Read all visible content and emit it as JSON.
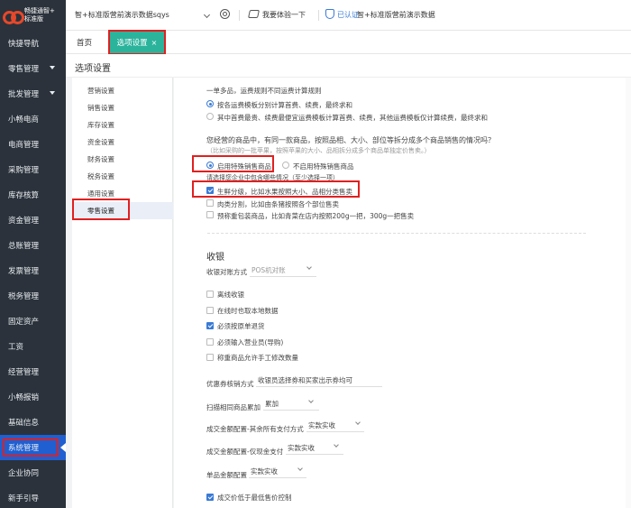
{
  "app": {
    "logo_text": "畅捷通智+\n标准版",
    "account": "智+标准版营前演示数据sqys",
    "try_label": "我要体验一下",
    "cert_label": "已认证",
    "org_label": "智+标准版营前演示数据"
  },
  "sidebar": {
    "items": [
      {
        "label": "快捷导航",
        "caret": false
      },
      {
        "label": "零售管理",
        "caret": true
      },
      {
        "label": "批发管理",
        "caret": true
      },
      {
        "label": "小畅电商",
        "caret": false
      },
      {
        "label": "电商管理",
        "caret": false
      },
      {
        "label": "采购管理",
        "caret": false
      },
      {
        "label": "库存核算",
        "caret": false
      },
      {
        "label": "资金管理",
        "caret": false
      },
      {
        "label": "总账管理",
        "caret": false
      },
      {
        "label": "发票管理",
        "caret": false
      },
      {
        "label": "税务管理",
        "caret": false
      },
      {
        "label": "固定资产",
        "caret": false
      },
      {
        "label": "工资",
        "caret": false
      },
      {
        "label": "经营管理",
        "caret": false
      },
      {
        "label": "小畅报销",
        "caret": false
      },
      {
        "label": "基础信息",
        "caret": false
      },
      {
        "label": "系统管理",
        "caret": false,
        "active": true
      },
      {
        "label": "企业协同",
        "caret": false
      },
      {
        "label": "新手引导",
        "caret": false
      }
    ]
  },
  "tabs": {
    "home": "首页",
    "options": "选项设置",
    "close": "×"
  },
  "page_title": "选项设置",
  "option_menu": {
    "items": [
      "营销设置",
      "销售设置",
      "库存设置",
      "资金设置",
      "财务设置",
      "税务设置",
      "通用设置",
      "零售设置"
    ],
    "active_index": 7
  },
  "panel": {
    "multi_product_label": "一单多品，运费规则不同运费计算规则",
    "freight_opt1": "按各运费模板分别计算首费、续费，最终求和",
    "freight_opt2": "其中首费最贵、续费最便宜运费模板计算首费、续费，其他运费模板仅计算续费，最终求和",
    "special_question": "您经营的商品中，有同一款商品，按照品相、大小、部位等拆分成多个商品销售的情况吗？",
    "special_question_hint": "（比如采购的一批苹果，按照苹果的大小、品相拆分成多个商品单独定价售卖。）",
    "special_enable": "启用特殊销售商品",
    "special_disable": "不启用特殊销售商品",
    "special_choose": "请选择您企业中包含哪些情况（至少选择一项）",
    "case1": "生鲜分级，比如水果按照大小、品相分类售卖",
    "case2": "肉类分割，比如由条猪按照各个部位售卖",
    "case3": "预称重包装商品，比如青菜在店内按照200g一把，300g一把售卖",
    "cash_heading": "收银",
    "cash_method_label": "收银对账方式",
    "cash_method_value": "POS机对账",
    "opt_offline": "离线收银",
    "opt_online_local": "在线时也取本地数据",
    "opt_must_return": "必须按原单退货",
    "opt_must_sales": "必须输入营业员(导购)",
    "opt_weigh": "称重商品允许手工修改数量",
    "coupon_label": "优惠券核销方式",
    "coupon_value": "收银员选择券和买家出示券均可",
    "scan_label": "扫描相同商品累加",
    "scan_value": "累加",
    "pay_all_label": "成交金额配置-其余所有支付方式",
    "pay_all_value": "实款实收",
    "pay_cash_label": "成交金额配置-仅现金支付",
    "pay_cash_value": "实款实收",
    "unit_label": "单品金额配置",
    "unit_value": "实款实收",
    "opt_min_price": "成交价低于最低售价控制"
  },
  "colors": {
    "sidebar_bg": "#2b323b",
    "active_blue": "#1f5fd1",
    "tab_green": "#2bb39c",
    "highlight_red": "#e02020",
    "link_blue": "#3a7bd5"
  }
}
